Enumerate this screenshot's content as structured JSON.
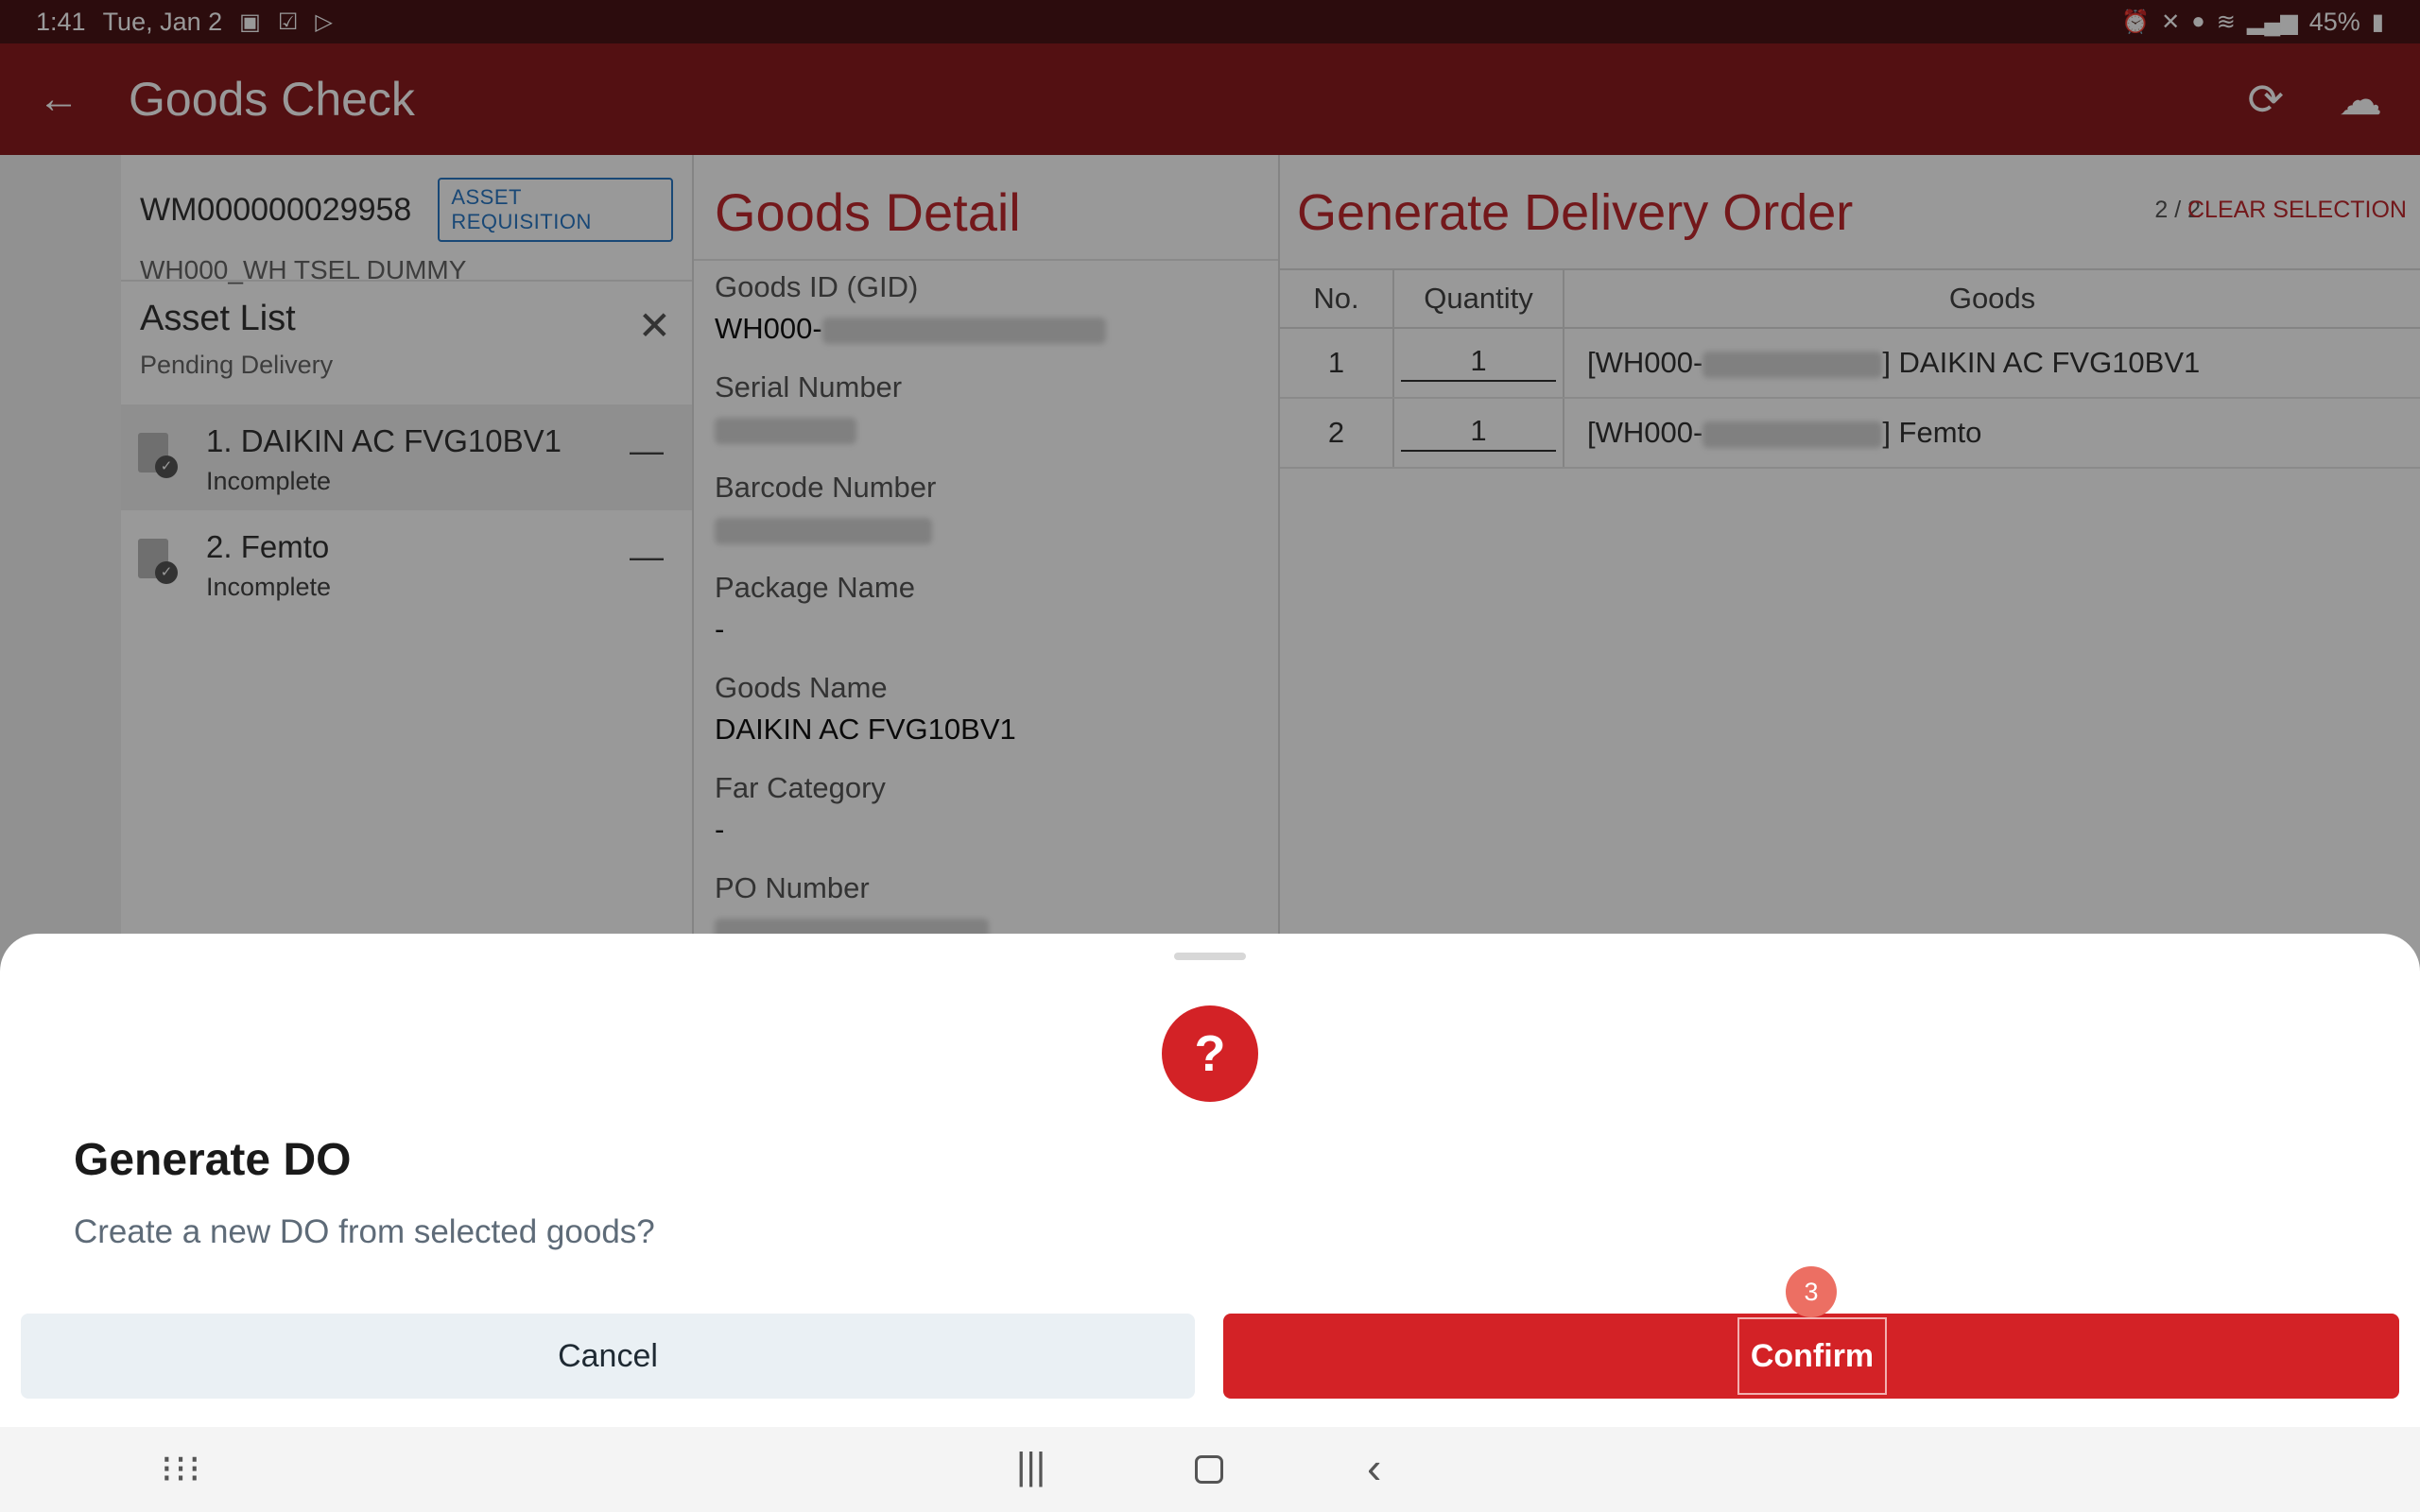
{
  "status_bar": {
    "time": "1:41",
    "date": "Tue, Jan 2",
    "battery": "45%",
    "icons": [
      "gallery-icon",
      "checkbox-icon",
      "play-store-icon",
      "alarm-icon",
      "mute-icon",
      "location-icon",
      "wifi-icon",
      "signal-icon",
      "battery-icon"
    ]
  },
  "app_bar": {
    "title": "Goods Check",
    "back_icon": "arrow-left-icon",
    "actions": [
      "refresh-icon",
      "cloud-upload-icon"
    ]
  },
  "warehouse": {
    "id": "WM000000029958",
    "tag": "ASSET REQUISITION",
    "name": "WH000_WH TSEL DUMMY"
  },
  "asset_list": {
    "title": "Asset List",
    "subtitle": "Pending Delivery",
    "items": [
      {
        "name": "1. DAIKIN AC FVG10BV1",
        "status": "Incomplete"
      },
      {
        "name": "2. Femto",
        "status": "Incomplete"
      }
    ]
  },
  "goods_detail": {
    "title": "Goods Detail",
    "fields": [
      {
        "label": "Goods ID (GID)",
        "value": "WH000-"
      },
      {
        "label": "Serial Number",
        "value": ""
      },
      {
        "label": "Barcode Number",
        "value": ""
      },
      {
        "label": "Package Name",
        "value": "-"
      },
      {
        "label": "Goods Name",
        "value": "DAIKIN AC FVG10BV1"
      },
      {
        "label": "Far Category",
        "value": "-"
      },
      {
        "label": "PO Number",
        "value": ""
      }
    ]
  },
  "delivery_order": {
    "title": "Generate Delivery Order",
    "count": "2 / 2",
    "clear_label": "CLEAR SELECTION",
    "columns": [
      "No.",
      "Quantity",
      "Goods"
    ],
    "rows": [
      {
        "no": "1",
        "qty": "1",
        "goods_prefix": "[WH000-",
        "goods_suffix": "] DAIKIN AC FVG10BV1"
      },
      {
        "no": "2",
        "qty": "1",
        "goods_prefix": "[WH000-",
        "goods_suffix": "] Femto"
      }
    ]
  },
  "dialog": {
    "icon": "?",
    "title": "Generate DO",
    "message": "Create a new DO from selected goods?",
    "cancel_label": "Cancel",
    "confirm_label": "Confirm",
    "step_badge": "3"
  },
  "colors": {
    "app_bar": "#8b1c1f",
    "accent_red": "#d32226",
    "title_red": "#c0282d",
    "tag_blue": "#2b78c5"
  }
}
